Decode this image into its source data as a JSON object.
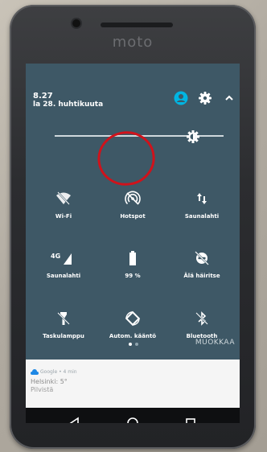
{
  "device": {
    "brand": "moto"
  },
  "header": {
    "time": "8.27",
    "date": "la 28. huhtikuuta",
    "icons": [
      "account-icon",
      "settings-icon",
      "collapse-chevron-icon"
    ]
  },
  "brightness": {
    "level": 0.82
  },
  "tiles": [
    {
      "label": "Wi-Fi",
      "icon": "wifi-off-icon"
    },
    {
      "label": "Hotspot",
      "icon": "hotspot-off-icon"
    },
    {
      "label": "Saunalahti",
      "icon": "data-arrows-icon"
    },
    {
      "label": "Saunalahti",
      "icon": "signal-4g-icon",
      "badge": "4G"
    },
    {
      "label": "99 %",
      "icon": "battery-icon"
    },
    {
      "label": "Älä häiritse",
      "icon": "do-not-disturb-off-icon"
    },
    {
      "label": "Taskulamppu",
      "icon": "flashlight-off-icon"
    },
    {
      "label": "Autom. kääntö",
      "icon": "auto-rotate-icon"
    },
    {
      "label": "Bluetooth",
      "icon": "bluetooth-off-icon"
    }
  ],
  "edit_label": "MUOKKAA",
  "pager": {
    "pages": 2,
    "current": 1
  },
  "notification": {
    "source": "Google • 4 min",
    "title": "Helsinki: 5°",
    "text": "Pilvistä"
  },
  "colors": {
    "panel": "#3e5866",
    "accent": "#00b5e2",
    "annotation": "#d0121b"
  }
}
